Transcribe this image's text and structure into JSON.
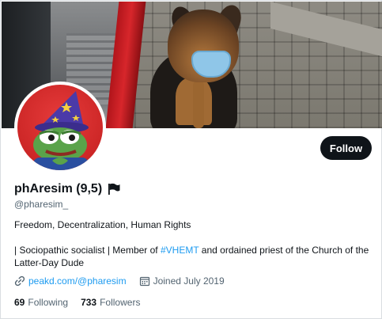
{
  "profile": {
    "display_name": "phAresim (9,5)",
    "handle": "@pharesim_",
    "bio_line1": "Freedom, Decentralization, Human Rights",
    "bio_part1": "| Sociopathic socialist | Member of ",
    "bio_hashtag": "#VHEMT",
    "bio_part2": " and ordained priest of the Church of the Latter-Day Dude",
    "website": "peakd.com/@pharesim",
    "joined": "Joined July 2019",
    "following_count": "69",
    "following_label": "Following",
    "followers_count": "733",
    "followers_label": "Followers"
  },
  "actions": {
    "follow_label": "Follow"
  },
  "icons": {
    "flag": "flag-icon",
    "link": "link-icon",
    "calendar": "calendar-icon"
  },
  "colors": {
    "accent": "#1d9bf0",
    "button_bg": "#0f1419",
    "secondary_text": "#536471"
  }
}
